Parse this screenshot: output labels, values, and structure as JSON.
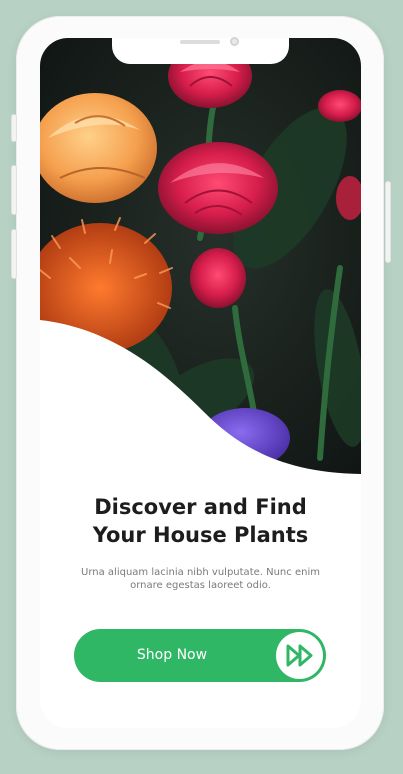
{
  "onboarding": {
    "title_line1": "Discover and Find",
    "title_line2": "Your House Plants",
    "description": "Urna aliquam lacinia nibh vulputate. Nunc enim ornare egestas laoreet odio.",
    "cta_label": "Shop Now",
    "cta_icon": "fast-forward-icon"
  },
  "colors": {
    "accent": "#2fb765",
    "background": "#b7d2c5",
    "title": "#1d1d1d",
    "description": "#7a7a7a"
  }
}
